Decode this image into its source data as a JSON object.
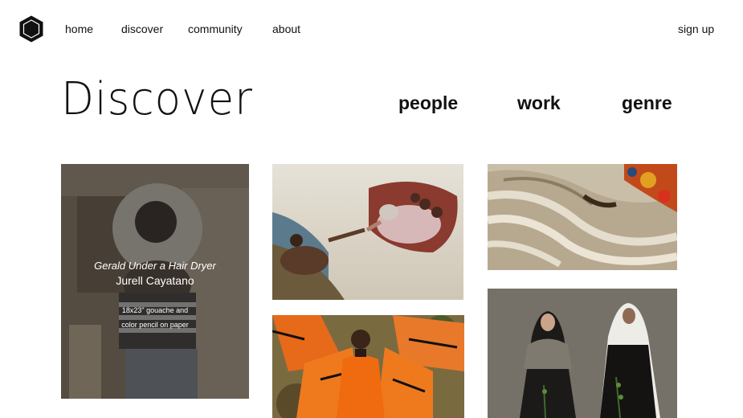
{
  "nav": {
    "home": "home",
    "discover": "discover",
    "community": "community",
    "about": "about",
    "sign_up": "sign up"
  },
  "page": {
    "title": "Discover"
  },
  "filters": {
    "people": "people",
    "work": "work",
    "genre": "genre"
  },
  "gallery": {
    "featured": {
      "title": "Gerald Under a Hair Dryer",
      "artist": "Jurell Cayatano",
      "medium_line1": "18x23\" gouache and",
      "medium_line2": "color pencil on paper"
    }
  },
  "icons": {
    "logo": "hexagon-logo-icon"
  }
}
